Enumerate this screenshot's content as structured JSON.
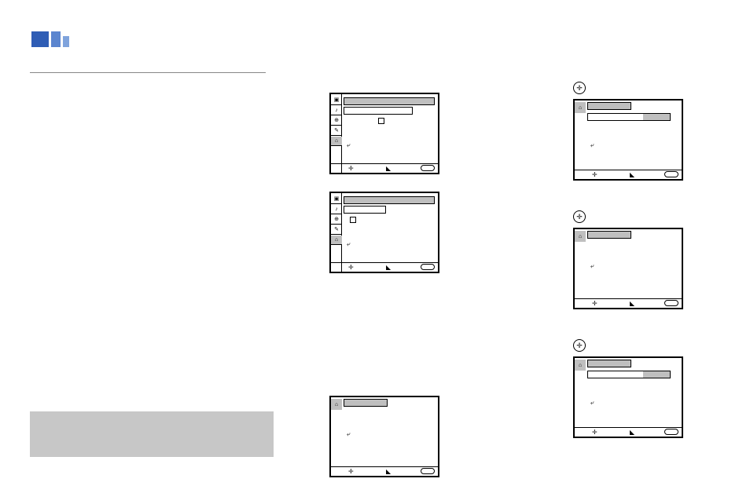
{
  "icons": {
    "camera": "▣",
    "music": "♪",
    "globe": "⊕",
    "wrench": "✎",
    "setup": "⌂",
    "return": "⤶",
    "plus": "✛",
    "pointer": "◣"
  },
  "joystick_marker": "✛"
}
